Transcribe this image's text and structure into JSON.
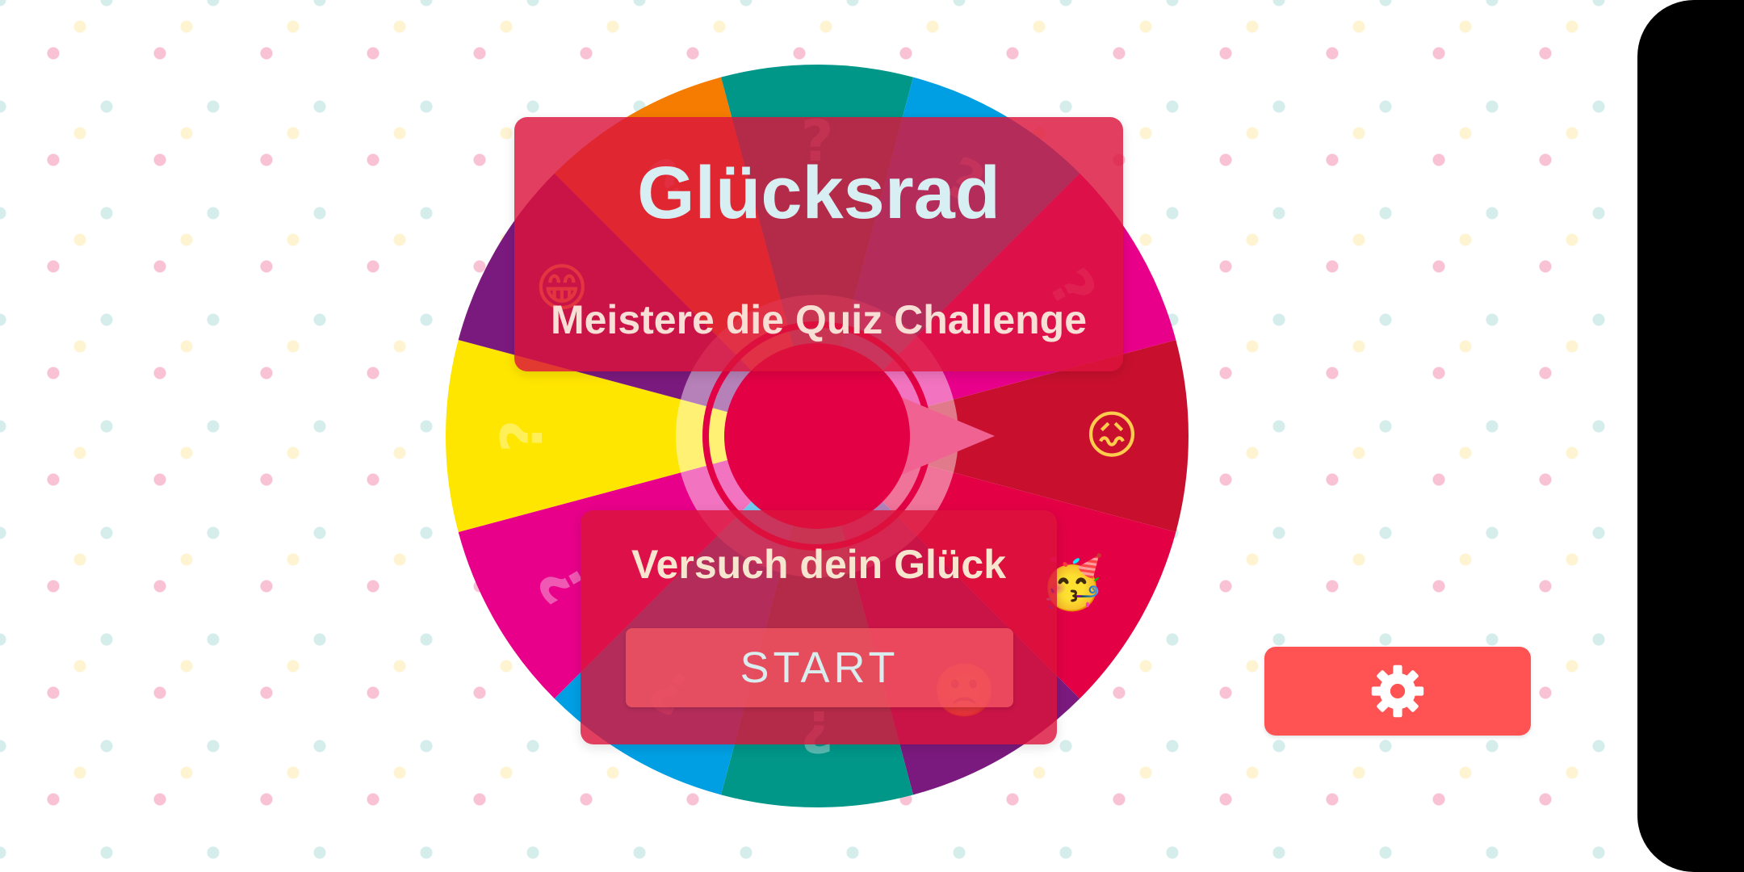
{
  "header": {
    "title": "Glücksrad",
    "subtitle": "Meistere die Quiz Challenge"
  },
  "start_panel": {
    "prompt": "Versuch dein Glück",
    "start_label": "START"
  },
  "settings": {
    "icon": "gear-icon"
  },
  "wheel": {
    "segments": [
      {
        "color": "#009688",
        "emoji": "question-icon"
      },
      {
        "color": "#009fe3",
        "emoji": "question-icon"
      },
      {
        "color": "#e8008a",
        "emoji": "question-icon"
      },
      {
        "color": "#c8102e",
        "emoji": "confounded-face-icon"
      },
      {
        "color": "#e30045",
        "emoji": "party-face-icon"
      },
      {
        "color": "#7b1a7e",
        "emoji": "frowning-face-icon"
      },
      {
        "color": "#009688",
        "emoji": "question-icon"
      },
      {
        "color": "#009fe3",
        "emoji": "question-icon"
      },
      {
        "color": "#e8008a",
        "emoji": "question-icon"
      },
      {
        "color": "#ffe600",
        "emoji": "question-icon"
      },
      {
        "color": "#7b1a7e",
        "emoji": "grinning-face-icon"
      },
      {
        "color": "#f57c00",
        "emoji": "question-icon"
      }
    ],
    "hub_color": "#e30045",
    "pointer_color": "#f06292"
  },
  "colors": {
    "panel": "#dc143c",
    "settings_button": "#ff5252",
    "right_bar": "#000000"
  }
}
